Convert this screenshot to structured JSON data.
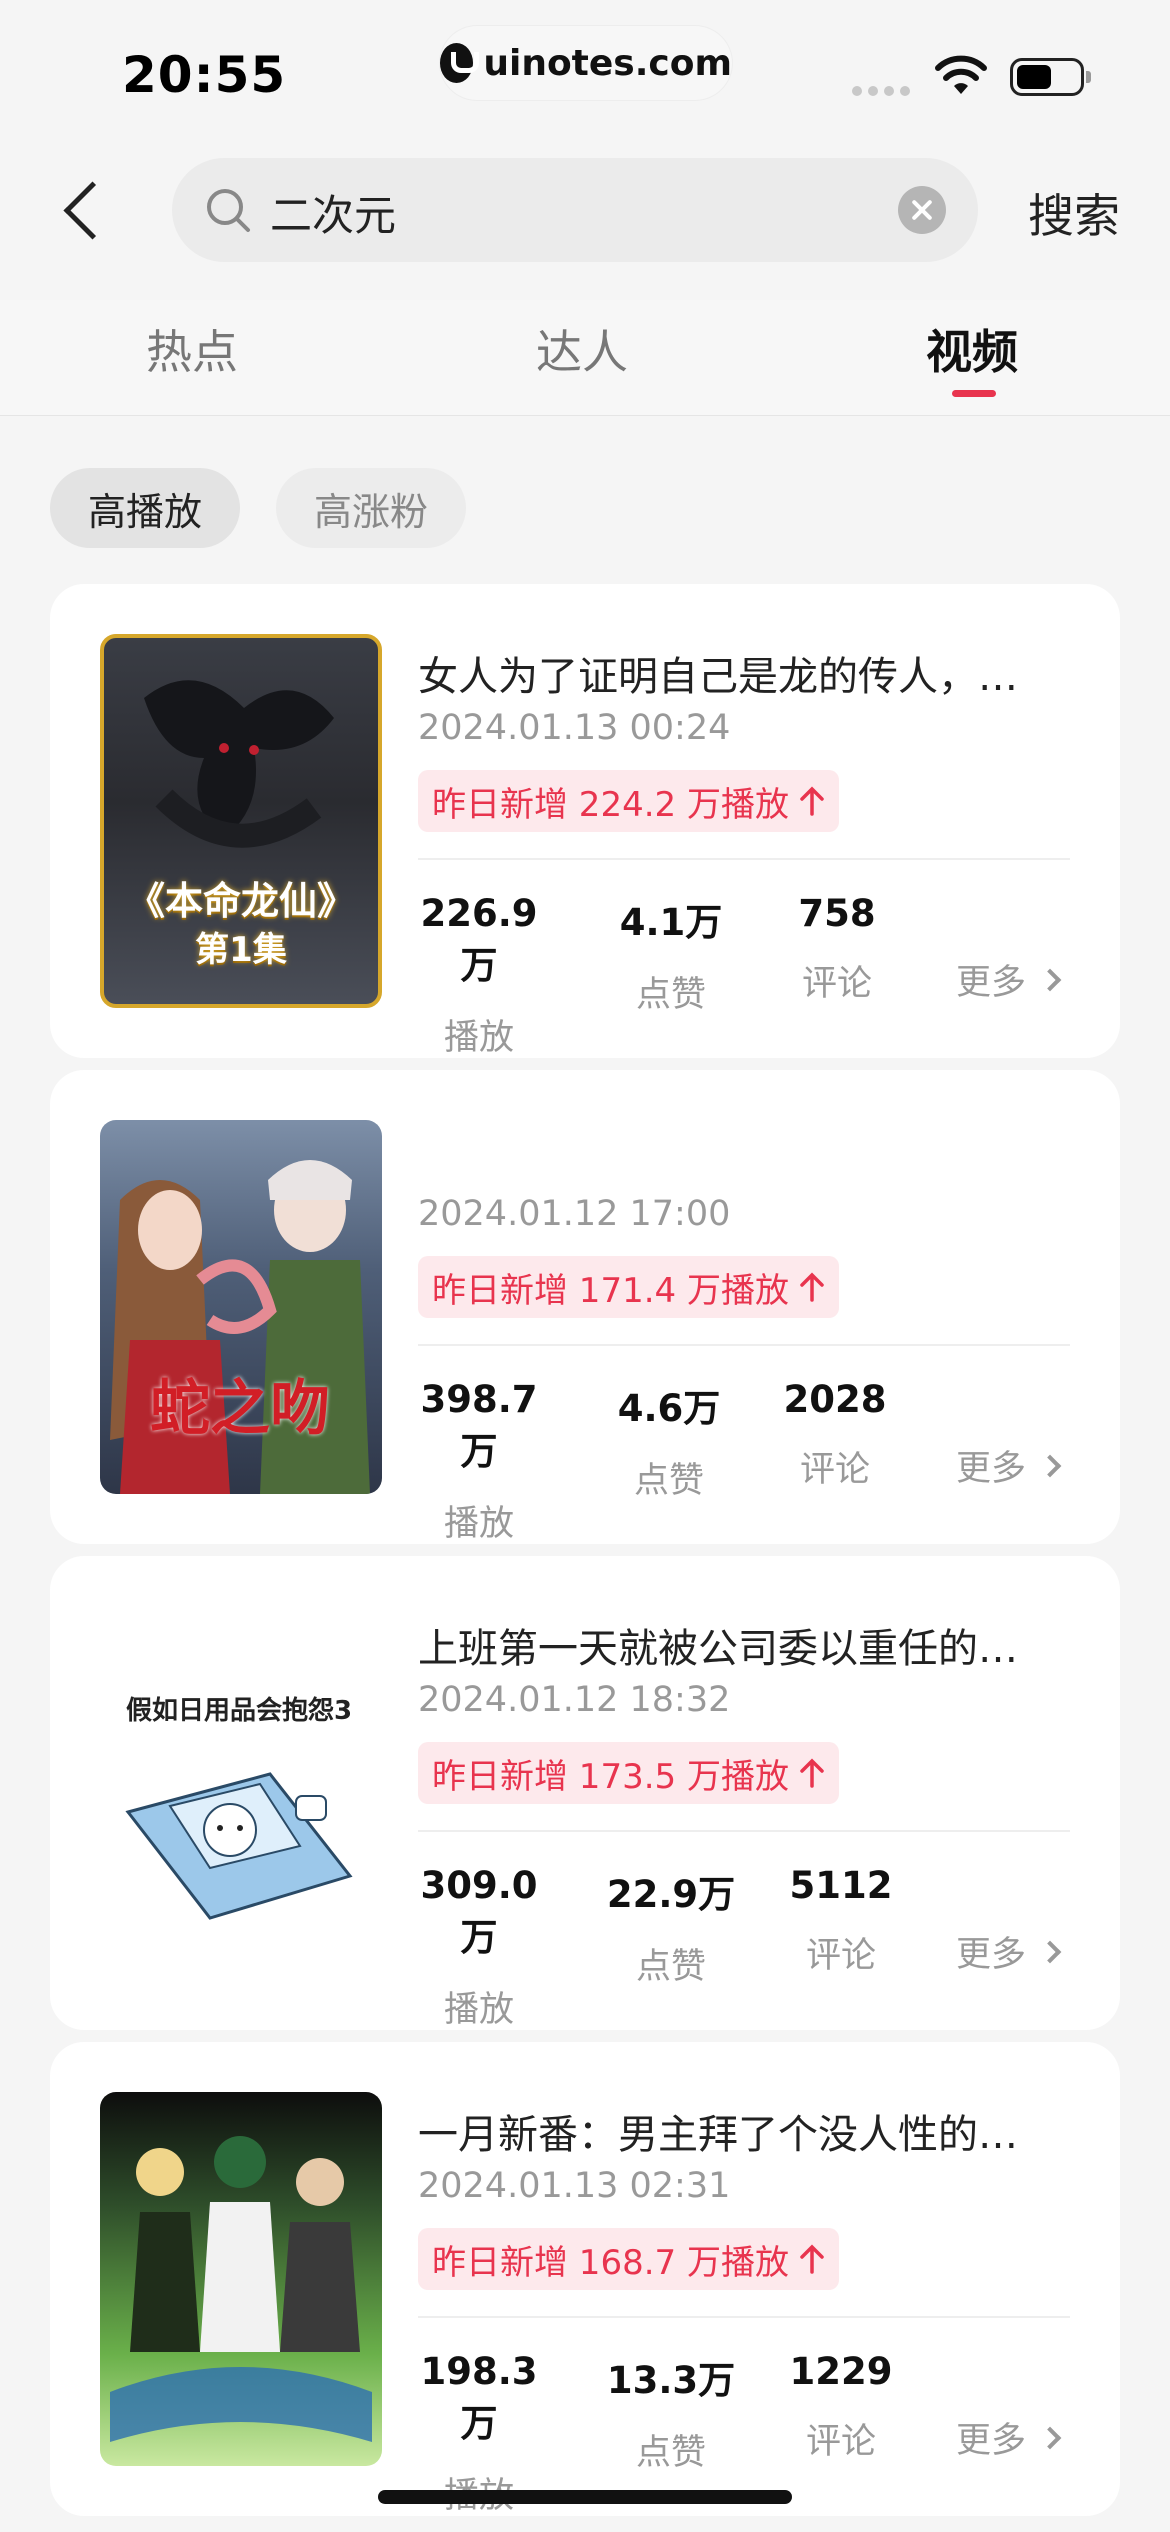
{
  "status_bar": {
    "time": "20:55",
    "site": "uinotes.com"
  },
  "search": {
    "value": "二次元",
    "button": "搜索"
  },
  "tabs": [
    {
      "label": "热点"
    },
    {
      "label": "达人"
    },
    {
      "label": "视频"
    }
  ],
  "active_tab": "视频",
  "filters": [
    {
      "label": "高播放"
    },
    {
      "label": "高涨粉"
    }
  ],
  "selected_filter": "高播放",
  "stat_labels": {
    "plays": "播放",
    "likes": "点赞",
    "comments": "评论"
  },
  "more_label": "更多",
  "colors": {
    "accent": "#e8344e",
    "chip_bg": "#e3e3e3",
    "growth_bg": "#fde9ec"
  },
  "videos": [
    {
      "title": "女人为了证明自己是龙的传人，…",
      "date": "2024.01.13 00:24",
      "growth": "昨日新增 224.2 万播放",
      "plays": "226.9万",
      "likes": "4.1万",
      "comments": "758",
      "thumb_text_1": "《本命龙仙》",
      "thumb_text_2": "第1集"
    },
    {
      "title": "",
      "date": "2024.01.12 17:00",
      "growth": "昨日新增 171.4 万播放",
      "plays": "398.7万",
      "likes": "4.6万",
      "comments": "2028",
      "thumb_text_1": "蛇之吻"
    },
    {
      "title": "上班第一天就被公司委以重任的…",
      "date": "2024.01.12 18:32",
      "growth": "昨日新增 173.5 万播放",
      "plays": "309.0万",
      "likes": "22.9万",
      "comments": "5112",
      "thumb_text_1": "假如日用品会抱怨3"
    },
    {
      "title": "一月新番：男主拜了个没人性的…",
      "date": "2024.01.13 02:31",
      "growth": "昨日新增 168.7 万播放",
      "plays": "198.3万",
      "likes": "13.3万",
      "comments": "1229"
    }
  ]
}
